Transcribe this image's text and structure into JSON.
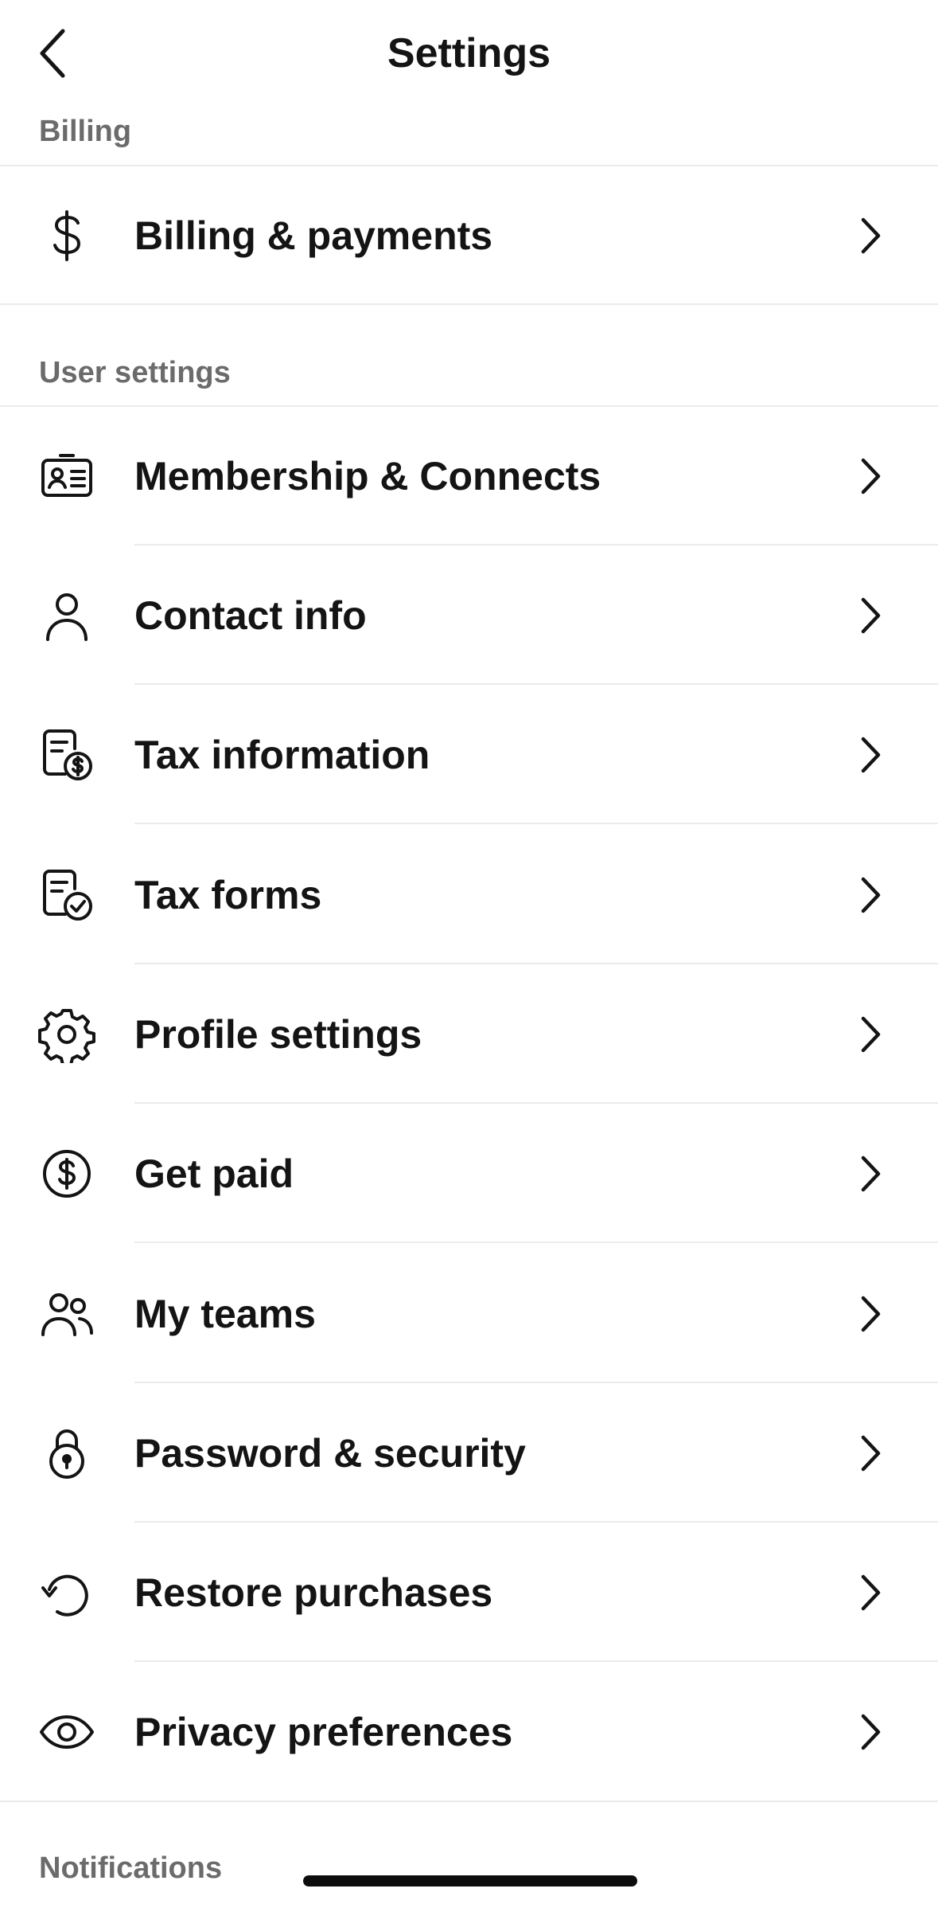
{
  "header": {
    "title": "Settings"
  },
  "sections": {
    "billing": "Billing",
    "user_settings": "User settings",
    "notifications": "Notifications"
  },
  "rows": {
    "billing_payments": "Billing & payments",
    "membership": "Membership & Connects",
    "contact": "Contact info",
    "tax_info": "Tax information",
    "tax_forms": "Tax forms",
    "profile": "Profile settings",
    "get_paid": "Get paid",
    "teams": "My teams",
    "security": "Password & security",
    "restore": "Restore purchases",
    "privacy": "Privacy preferences"
  },
  "icons": {
    "back": "chevron-left-icon",
    "dollar": "dollar-icon",
    "id_card": "id-card-icon",
    "person": "person-icon",
    "tax_info": "document-dollar-icon",
    "tax_forms": "document-check-icon",
    "gear": "gear-icon",
    "coin": "dollar-circle-icon",
    "people": "people-icon",
    "lock": "lock-icon",
    "restore": "restore-icon",
    "eye": "eye-icon",
    "chevron": "chevron-right-icon"
  },
  "colors": {
    "text": "#141414",
    "muted": "#6b6b6b",
    "divider": "#ebebeb"
  }
}
